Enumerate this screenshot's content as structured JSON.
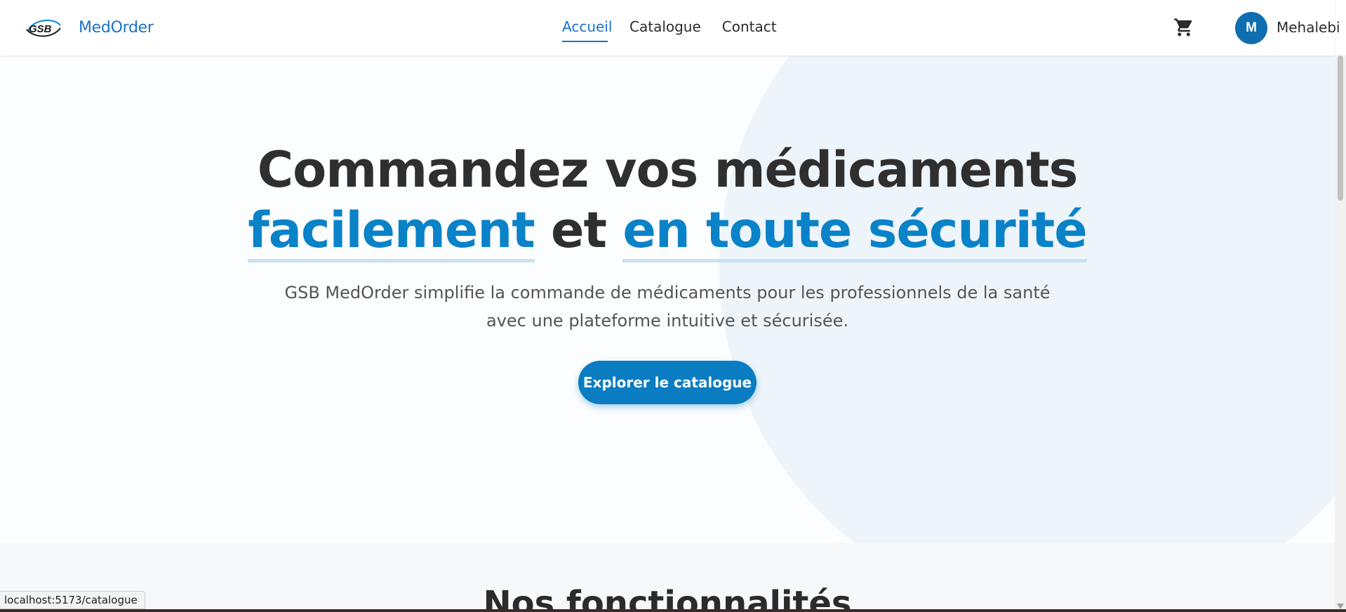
{
  "header": {
    "brand": "MedOrder",
    "logo_alt": "GSB",
    "nav": [
      {
        "label": "Accueil",
        "active": true
      },
      {
        "label": "Catalogue",
        "active": false
      },
      {
        "label": "Contact",
        "active": false
      }
    ],
    "cart_icon": "cart-icon",
    "avatar_initial": "M",
    "username": "Mehalebi"
  },
  "hero": {
    "title_line1": "Commandez vos médicaments",
    "title_hl1": "facilement",
    "title_mid": " et ",
    "title_hl2": "en toute sécurité",
    "subtitle_line1": "GSB MedOrder simplifie la commande de médicaments pour les professionnels de la santé",
    "subtitle_line2": "avec une plateforme intuitive et sécurisée.",
    "cta": "Explorer le catalogue"
  },
  "features": {
    "title": "Nos fonctionnalités"
  },
  "status": {
    "url": "localhost:5173/catalogue"
  },
  "colors": {
    "accent": "#1a73c8",
    "highlight": "#0a82c8",
    "button": "#0a7cc2"
  }
}
